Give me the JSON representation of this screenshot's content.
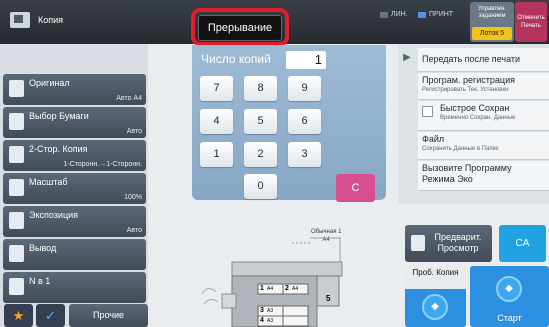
{
  "header": {
    "app_title": "Копия",
    "interrupt_label": "Прерывание",
    "status_line": "ЛИН.",
    "status_print": "ПРИНТ",
    "job_status_label": "Управлен. заданием",
    "job_queue": "Лоток 5",
    "cancel_print_label": "Отменить Печать"
  },
  "left_panel": {
    "items": [
      {
        "label": "Оригинал",
        "value": "Авто   A4",
        "icon": "document-icon"
      },
      {
        "label": "Выбор Бумаги",
        "value": "Авто",
        "icon": "paper-icon"
      },
      {
        "label": "2-Стор. Копия",
        "value": "1-Сторонн.→1-Сторонн.",
        "icon": "duplex-icon"
      },
      {
        "label": "Масштаб",
        "value": "100%",
        "icon": "scale-icon"
      },
      {
        "label": "Экспозиция",
        "value": "Авто",
        "icon": "exposure-icon"
      },
      {
        "label": "Вывод",
        "value": "",
        "icon": "output-icon"
      },
      {
        "label": "N в 1",
        "value": "",
        "icon": "n-up-icon"
      }
    ],
    "others_label": "Прочие"
  },
  "keypad": {
    "label": "Число копий",
    "value": "1",
    "keys": [
      "7",
      "8",
      "9",
      "4",
      "5",
      "6",
      "1",
      "2",
      "3",
      "0"
    ],
    "clear": "C"
  },
  "preview": {
    "tray_label": "Обычная 1",
    "tray_size": "A4",
    "tray1_size": "A4",
    "tray2_size": "A4",
    "tray3_size": "A3",
    "tray4_size": "A3",
    "tray_nums": [
      "1",
      "2",
      "3",
      "4",
      "5"
    ]
  },
  "right_panel": {
    "items": [
      {
        "label": "Передать после печати",
        "sub": ""
      },
      {
        "label": "Програм. регистрация",
        "sub": "Регистрировать Тек. Установки"
      },
      {
        "label": "Быстрое Сохран",
        "sub": "Временно Сохран. Данные"
      },
      {
        "label": "Файл",
        "sub": "Сохранить Данные в Папке"
      },
      {
        "label": "Вызовите Программу Режима Эко",
        "sub": ""
      }
    ]
  },
  "actions": {
    "preview_label": "Предварит. Просмотр",
    "ca_label": "CA",
    "proof_label": "Проб. Копия",
    "start_label": "Старт"
  }
}
